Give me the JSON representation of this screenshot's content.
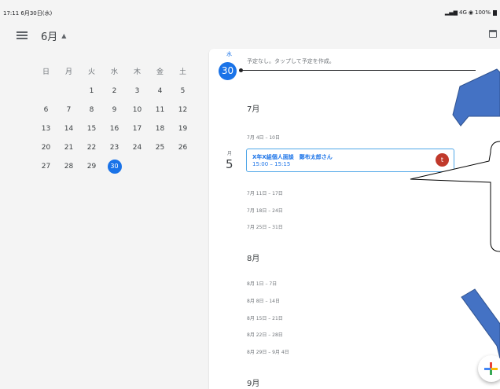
{
  "status_bar": {
    "time": "17:11 6月30日(水)",
    "network": "4G",
    "battery": "100%"
  },
  "header": {
    "month": "6月",
    "caret": "▲"
  },
  "mini_calendar": {
    "weekdays": [
      "日",
      "月",
      "火",
      "水",
      "木",
      "金",
      "土"
    ],
    "weeks": [
      [
        "",
        "",
        "1",
        "2",
        "3",
        "4",
        "5"
      ],
      [
        "6",
        "7",
        "8",
        "9",
        "10",
        "11",
        "12"
      ],
      [
        "13",
        "14",
        "15",
        "16",
        "17",
        "18",
        "19"
      ],
      [
        "20",
        "21",
        "22",
        "23",
        "24",
        "25",
        "26"
      ],
      [
        "27",
        "28",
        "29",
        "30",
        "",
        "",
        ""
      ]
    ],
    "selected": "30"
  },
  "schedule": {
    "today": {
      "dow": "水",
      "day": "30",
      "no_events_text": "予定なし。タップして予定を作成。"
    },
    "months": [
      {
        "label": "7月",
        "week_before_event": "7月 4日 – 10日",
        "event": {
          "dow": "月",
          "day": "5",
          "title": "X年X組個人面談　鄭布太郎さん",
          "time": "15:00 – 15:15",
          "avatar_letter": "t"
        },
        "weeks_after_event": [
          "7月 11日 – 17日",
          "7月 18日 – 24日",
          "7月 25日 – 31日"
        ]
      },
      {
        "label": "8月",
        "weeks": [
          "8月 1日 – 7日",
          "8月 8日 – 14日",
          "8月 15日 – 21日",
          "8月 22日 – 28日",
          "8月 29日 – 9月 4日"
        ]
      },
      {
        "label": "9月"
      }
    ]
  },
  "colors": {
    "accent": "#1a73e8",
    "event_border": "#4fa6e8",
    "avatar": "#c0392b",
    "annotation_arrow": "#4472c4"
  },
  "icons": {
    "menu": "menu-icon",
    "calendar_today": "calendar-today-icon",
    "fab": "plus-icon"
  }
}
